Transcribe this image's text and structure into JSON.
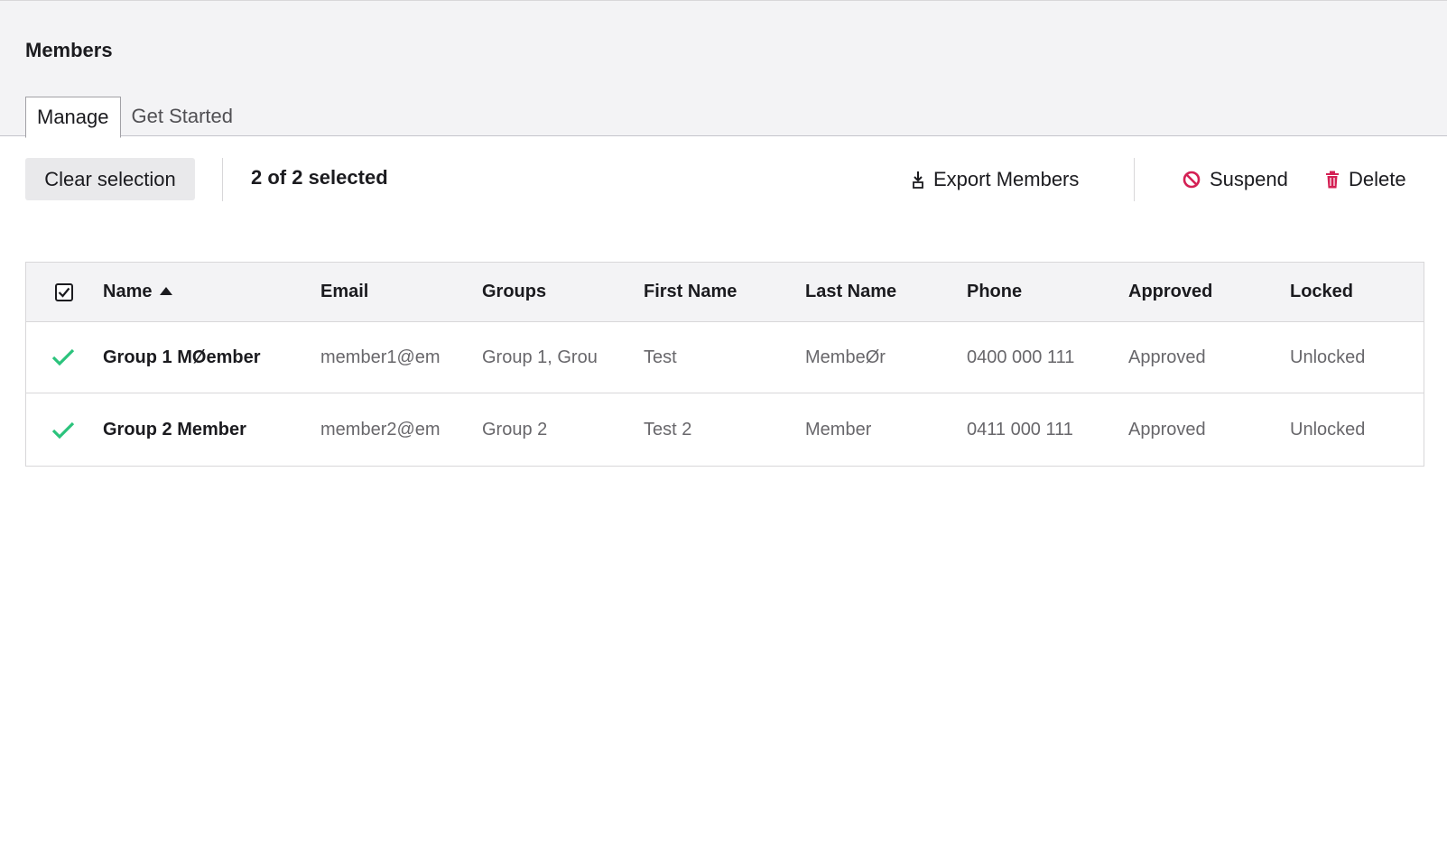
{
  "page": {
    "title": "Members"
  },
  "tabs": [
    {
      "label": "Manage",
      "active": true
    },
    {
      "label": "Get Started",
      "active": false
    }
  ],
  "toolbar": {
    "clear_label": "Clear selection",
    "selected_text": "2 of 2 selected",
    "export_label": "Export Members",
    "suspend_label": "Suspend",
    "delete_label": "Delete",
    "danger_color": "#d42054",
    "export_icon": "download-icon",
    "suspend_icon": "block-icon",
    "delete_icon": "trash-icon"
  },
  "table": {
    "columns": [
      "Name",
      "Email",
      "Groups",
      "First Name",
      "Last Name",
      "Phone",
      "Approved",
      "Locked"
    ],
    "sort": {
      "column": "Name",
      "direction": "ascending"
    },
    "header_checkbox_checked": true,
    "check_color": "#2bc37c",
    "rows": [
      {
        "selected": true,
        "name": "Group 1 MØember",
        "email": "member1@em",
        "groups": "Group 1, Grou",
        "first_name": "Test",
        "last_name": "MembeØr",
        "phone": "0400 000 111",
        "approved": "Approved",
        "locked": "Unlocked"
      },
      {
        "selected": true,
        "name": "Group 2 Member",
        "email": "member2@em",
        "groups": "Group 2",
        "first_name": "Test 2",
        "last_name": "Member",
        "phone": "0411 000 111",
        "approved": "Approved",
        "locked": "Unlocked"
      }
    ]
  }
}
